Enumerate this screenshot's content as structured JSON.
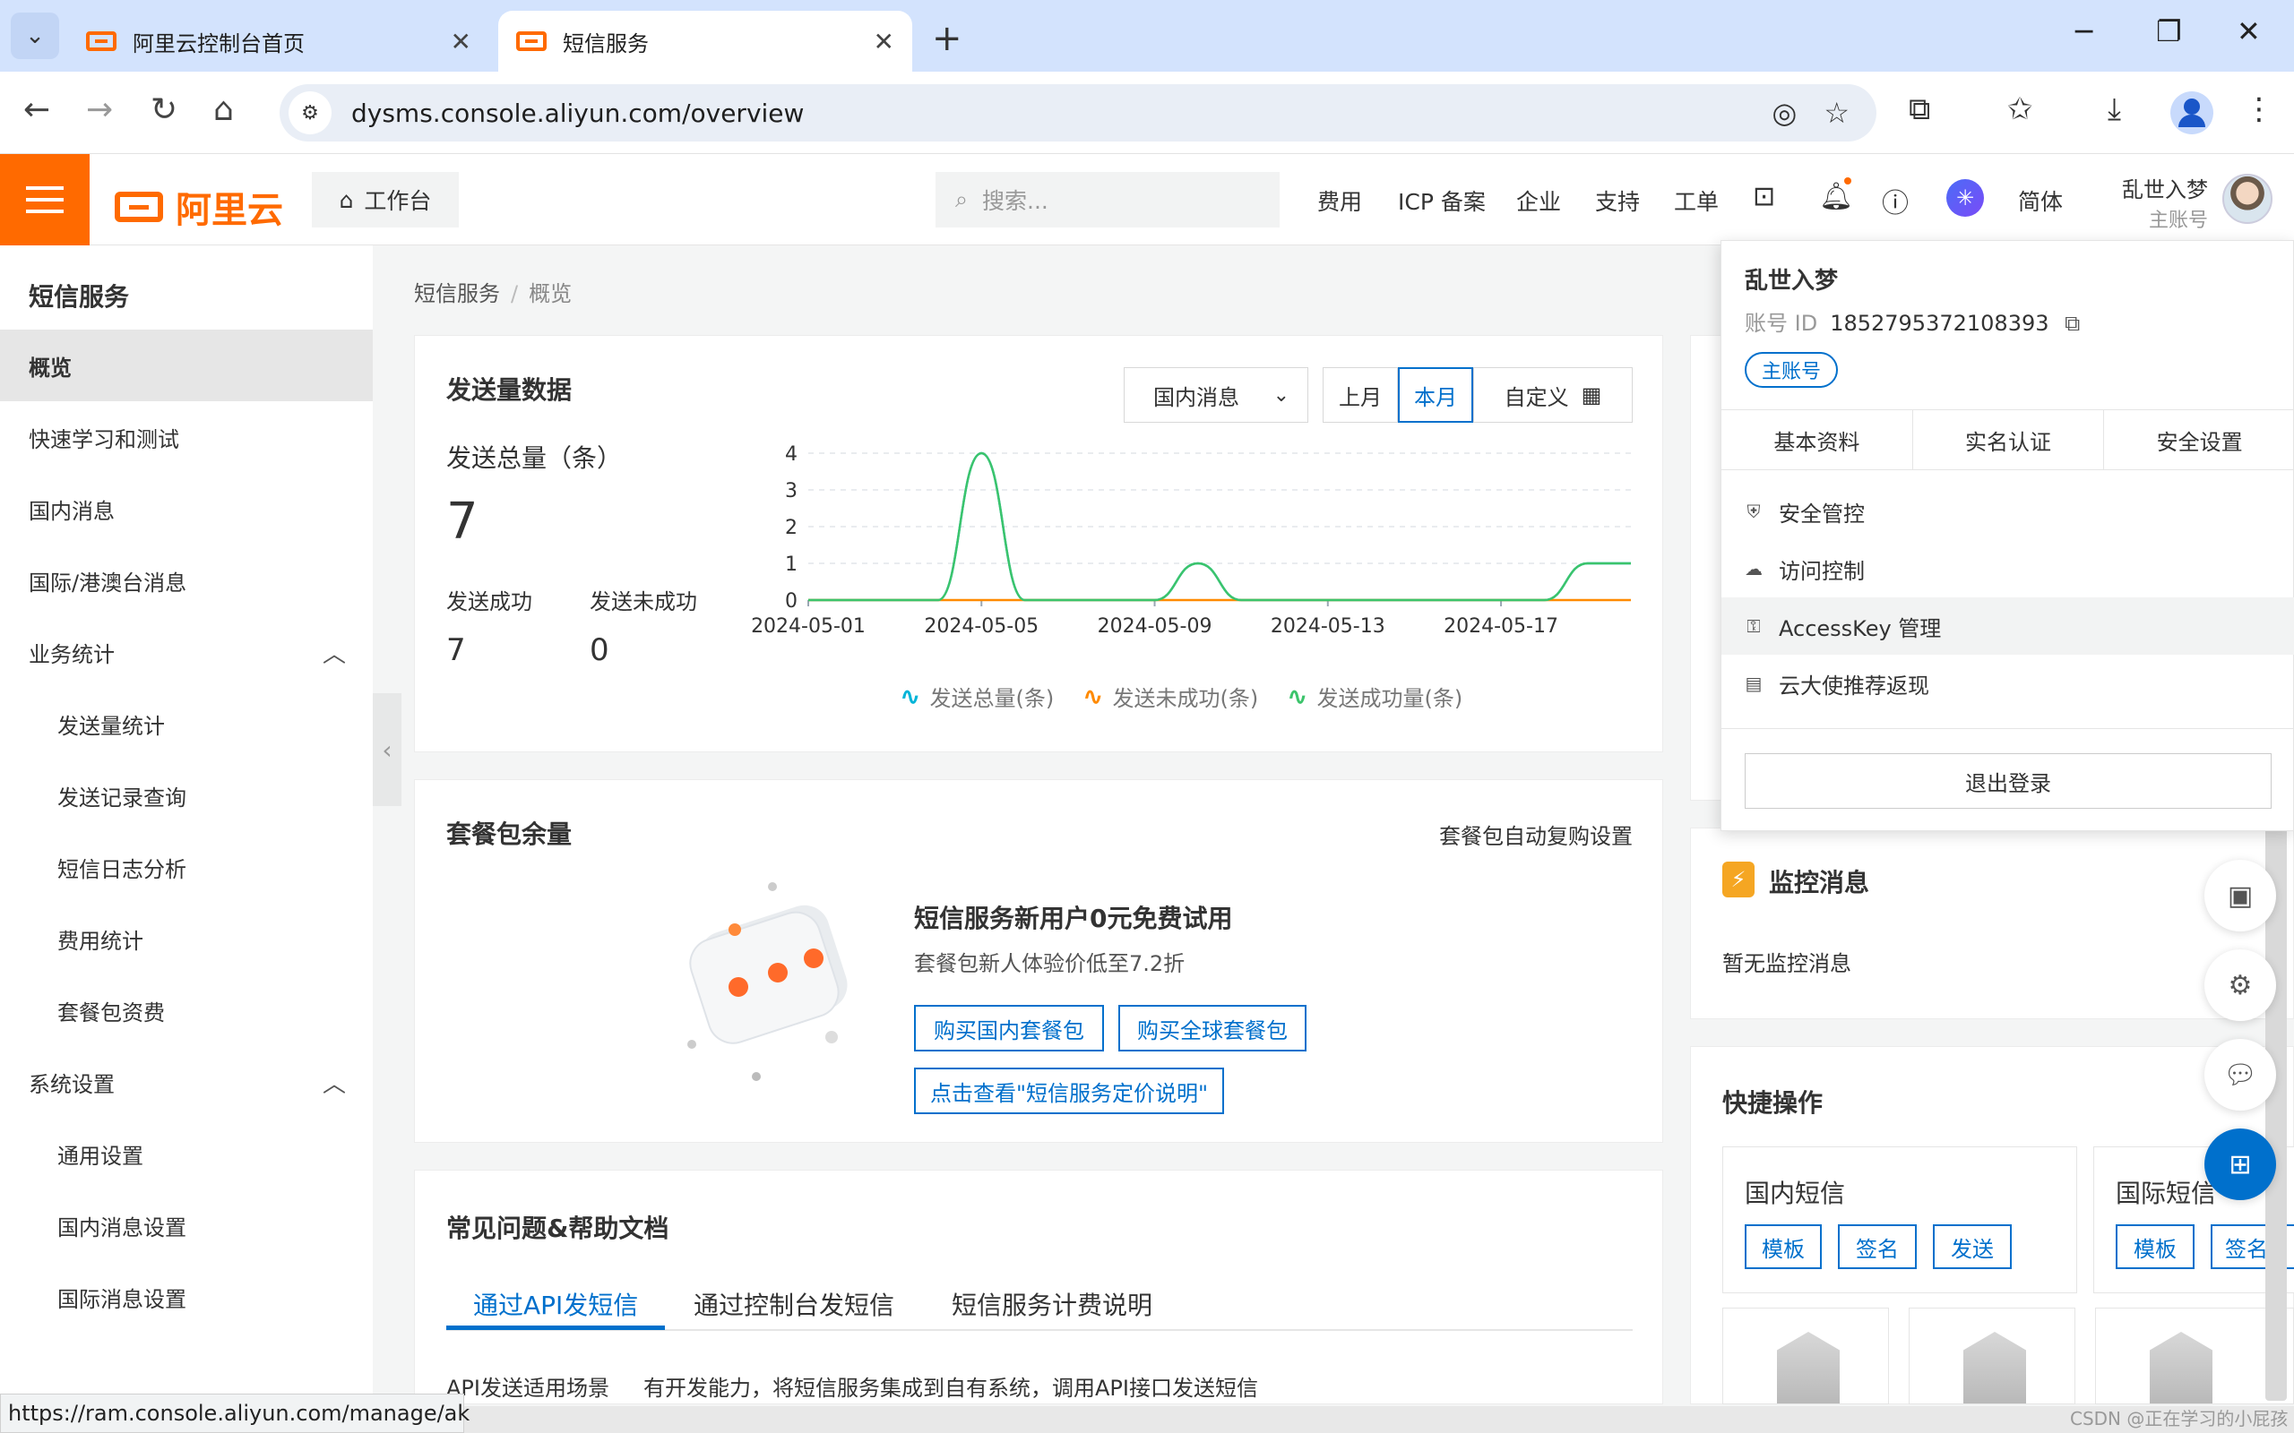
{
  "browser": {
    "tabs": [
      {
        "title": "阿里云控制台首页",
        "active": false
      },
      {
        "title": "短信服务",
        "active": true
      }
    ],
    "url": "dysms.console.aliyun.com/overview",
    "status_url": "https://ram.console.aliyun.com/manage/ak"
  },
  "header": {
    "brand": "阿里云",
    "workbench": "工作台",
    "search_placeholder": "搜索...",
    "nav": [
      "费用",
      "ICP 备案",
      "企业",
      "支持",
      "工单"
    ],
    "lang": "简体",
    "user_name": "乱世入梦",
    "user_role": "主账号"
  },
  "sidebar": {
    "title": "短信服务",
    "items": [
      {
        "label": "概览",
        "active": true
      },
      {
        "label": "快速学习和测试"
      },
      {
        "label": "国内消息"
      },
      {
        "label": "国际/港澳台消息"
      },
      {
        "label": "业务统计",
        "group": true
      },
      {
        "label": "发送量统计",
        "sub": true
      },
      {
        "label": "发送记录查询",
        "sub": true
      },
      {
        "label": "短信日志分析",
        "sub": true
      },
      {
        "label": "费用统计",
        "sub": true
      },
      {
        "label": "套餐包资费",
        "sub": true
      },
      {
        "label": "系统设置",
        "group": true
      },
      {
        "label": "通用设置",
        "sub": true
      },
      {
        "label": "国内消息设置",
        "sub": true
      },
      {
        "label": "国际消息设置",
        "sub": true
      }
    ]
  },
  "breadcrumb": {
    "root": "短信服务",
    "sep": "/",
    "current": "概览"
  },
  "send_stats": {
    "title": "发送量数据",
    "region_select": "国内消息",
    "ranges": [
      "上月",
      "本月",
      "自定义"
    ],
    "selected_range": "本月",
    "total_label": "发送总量（条）",
    "total_value": "7",
    "success_label": "发送成功",
    "success_value": "7",
    "fail_label": "发送未成功",
    "fail_value": "0"
  },
  "chart_data": {
    "type": "line",
    "x": [
      "2024-05-01",
      "2024-05-02",
      "2024-05-03",
      "2024-05-04",
      "2024-05-05",
      "2024-05-06",
      "2024-05-07",
      "2024-05-08",
      "2024-05-09",
      "2024-05-10",
      "2024-05-11",
      "2024-05-12",
      "2024-05-13",
      "2024-05-14",
      "2024-05-15",
      "2024-05-16",
      "2024-05-17",
      "2024-05-18",
      "2024-05-19",
      "2024-05-20"
    ],
    "x_ticks": [
      "2024-05-01",
      "2024-05-05",
      "2024-05-09",
      "2024-05-13",
      "2024-05-17"
    ],
    "y_ticks": [
      "0",
      "1",
      "2",
      "3",
      "4"
    ],
    "ylim": [
      0,
      4
    ],
    "grid": true,
    "legend_position": "bottom",
    "series": [
      {
        "name": "发送总量(条)",
        "color": "#00b4d8",
        "values": [
          0,
          0,
          0,
          0,
          4,
          0,
          0,
          0,
          0,
          1,
          0,
          0,
          0,
          0,
          0,
          0,
          0,
          0,
          1,
          1
        ]
      },
      {
        "name": "发送未成功(条)",
        "color": "#ff8a00",
        "values": [
          0,
          0,
          0,
          0,
          0,
          0,
          0,
          0,
          0,
          0,
          0,
          0,
          0,
          0,
          0,
          0,
          0,
          0,
          0,
          0
        ]
      },
      {
        "name": "发送成功量(条)",
        "color": "#3cc46b",
        "values": [
          0,
          0,
          0,
          0,
          4,
          0,
          0,
          0,
          0,
          1,
          0,
          0,
          0,
          0,
          0,
          0,
          0,
          0,
          1,
          1
        ]
      }
    ]
  },
  "package": {
    "title": "套餐包余量",
    "auto_renew": "套餐包自动复购设置",
    "promo_title": "短信服务新用户0元免费试用",
    "promo_sub": "套餐包新人体验价低至7.2折",
    "btn_domestic": "购买国内套餐包",
    "btn_global": "购买全球套餐包",
    "btn_pricing": "点击查看\"短信服务定价说明\""
  },
  "help": {
    "title": "常见问题&帮助文档",
    "tabs": [
      "通过API发短信",
      "通过控制台发短信",
      "短信服务计费说明"
    ],
    "row_label": "API发送适用场景",
    "row_text": "有开发能力，将短信服务集成到自有系统，调用API接口发送短信"
  },
  "monitor": {
    "title": "监控消息",
    "empty": "暂无监控消息"
  },
  "quick": {
    "title": "快捷操作",
    "boxes": [
      {
        "title": "国内短信",
        "buttons": [
          "模板",
          "签名",
          "发送"
        ]
      },
      {
        "title": "国际短信",
        "buttons": [
          "模板",
          "签名"
        ]
      }
    ]
  },
  "dropdown": {
    "name": "乱世入梦",
    "id_label": "账号 ID",
    "id_value": "1852795372108393",
    "badge": "主账号",
    "tabs": [
      "基本资料",
      "实名认证",
      "安全设置"
    ],
    "items": [
      "安全管控",
      "访问控制",
      "AccessKey 管理",
      "云大使推荐返现"
    ],
    "logout": "退出登录"
  },
  "watermark": "CSDN @正在学习的小屁孩"
}
